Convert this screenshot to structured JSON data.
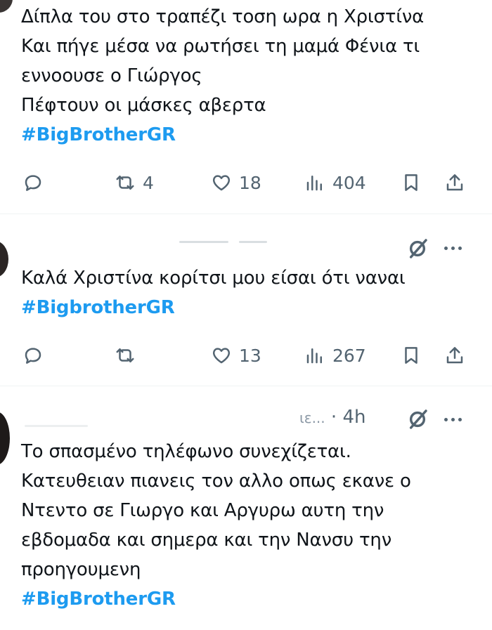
{
  "tweets": [
    {
      "lines": [
        "Δίπλα του στο τραπέζι τοση ωρα η Χριστίνα",
        "Και πήγε μέσα να ρωτήσει τη μαμά Φένια τι",
        "εννοουσε ο Γιώργος",
        "Πέφτουν οι μάσκες αβερτα"
      ],
      "hashtag": "#BigBrotherGR",
      "reposts": "4",
      "likes": "18",
      "views": "404"
    },
    {
      "lines": [
        "Καλά Χριστίνα κορίτσι μου είσαι ότι ναναι"
      ],
      "hashtag": "#BigbrotherGR",
      "reposts": "",
      "likes": "13",
      "views": "267"
    },
    {
      "handle_fragment": "ιε...",
      "time": "· 4h",
      "lines": [
        "Το σπασμένο τηλέφωνο συνεχίζεται.",
        "Κατευθειαν πιανεις τον αλλο οπως εκανε ο",
        "Ντεντο σε Γιωργο και Αργυρω αυτη την",
        "εβδομαδα και σημερα και την Νανσυ την",
        "προηγουμενη"
      ],
      "hashtag": "#BigBrotherGR"
    }
  ],
  "icons": {
    "reply": "reply-icon",
    "repost": "repost-icon",
    "like": "heart-icon",
    "views": "views-icon",
    "bookmark": "bookmark-icon",
    "share": "share-icon",
    "grok": "grok-icon",
    "more": "more-icon"
  },
  "colors": {
    "hashtag": "#1d9bf0",
    "text": "#0f1419",
    "muted": "#536471",
    "divider": "#eff3f4"
  }
}
